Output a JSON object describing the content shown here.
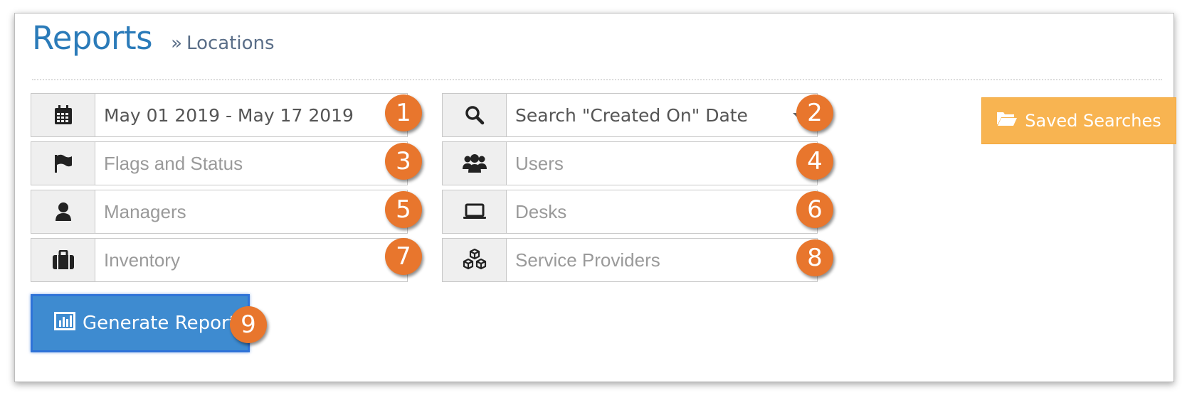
{
  "header": {
    "title": "Reports",
    "separator": "»",
    "breadcrumb": "Locations"
  },
  "filters": {
    "date_range": {
      "value": "May 01 2019 - May 17 2019",
      "icon": "calendar-icon"
    },
    "date_search": {
      "value": "Search \"Created On\" Date",
      "icon": "search-icon"
    },
    "flags_status": {
      "placeholder": "Flags and Status",
      "icon": "flag-icon"
    },
    "users": {
      "placeholder": "Users",
      "icon": "users-icon"
    },
    "managers": {
      "placeholder": "Managers",
      "icon": "user-icon"
    },
    "desks": {
      "placeholder": "Desks",
      "icon": "laptop-icon"
    },
    "inventory": {
      "placeholder": "Inventory",
      "icon": "briefcase-icon"
    },
    "service_providers": {
      "placeholder": "Service Providers",
      "icon": "cubes-icon"
    }
  },
  "buttons": {
    "saved_searches": "Saved Searches",
    "generate_report": "Generate Report"
  },
  "badges": [
    "1",
    "2",
    "3",
    "4",
    "5",
    "6",
    "7",
    "8",
    "9"
  ],
  "colors": {
    "accent_blue": "#2b7bb9",
    "badge_orange": "#e8762d",
    "saved_button": "#f8b451",
    "generate_button": "#3e8bd0"
  }
}
